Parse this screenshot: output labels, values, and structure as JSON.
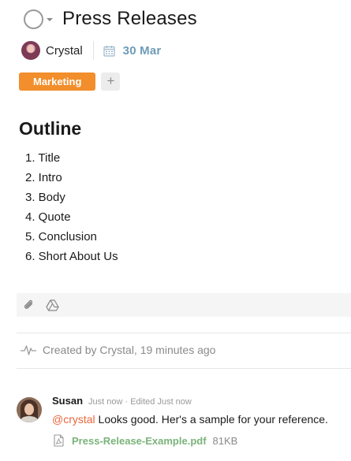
{
  "task": {
    "title": "Press Releases",
    "assignee": "Crystal",
    "due_date": "30 Mar",
    "tags": [
      "Marketing"
    ],
    "add_tag_label": "+"
  },
  "description": {
    "heading": "Outline",
    "items": [
      "1. Title",
      "2. Intro",
      "3. Body",
      "4. Quote",
      "5. Conclusion",
      "6. Short About Us"
    ]
  },
  "attachments_bar": {
    "icons": [
      "paperclip-icon",
      "google-drive-icon"
    ]
  },
  "activity": {
    "icon": "activity-pulse-icon",
    "text": "Created by Crystal, 19 minutes ago"
  },
  "comment": {
    "author": "Susan",
    "timestamp": "Just now · Edited Just now",
    "mention": "@crystal",
    "text": " Looks good. Her's a sample for your reference.",
    "attachment": {
      "icon": "pdf-file-icon",
      "name": "Press-Release-Example.pdf",
      "size": "81KB"
    }
  },
  "colors": {
    "tag_marketing": "#f28e2b",
    "due_date": "#6d9bb8",
    "mention": "#e8663d",
    "file_link": "#7ab37a"
  }
}
